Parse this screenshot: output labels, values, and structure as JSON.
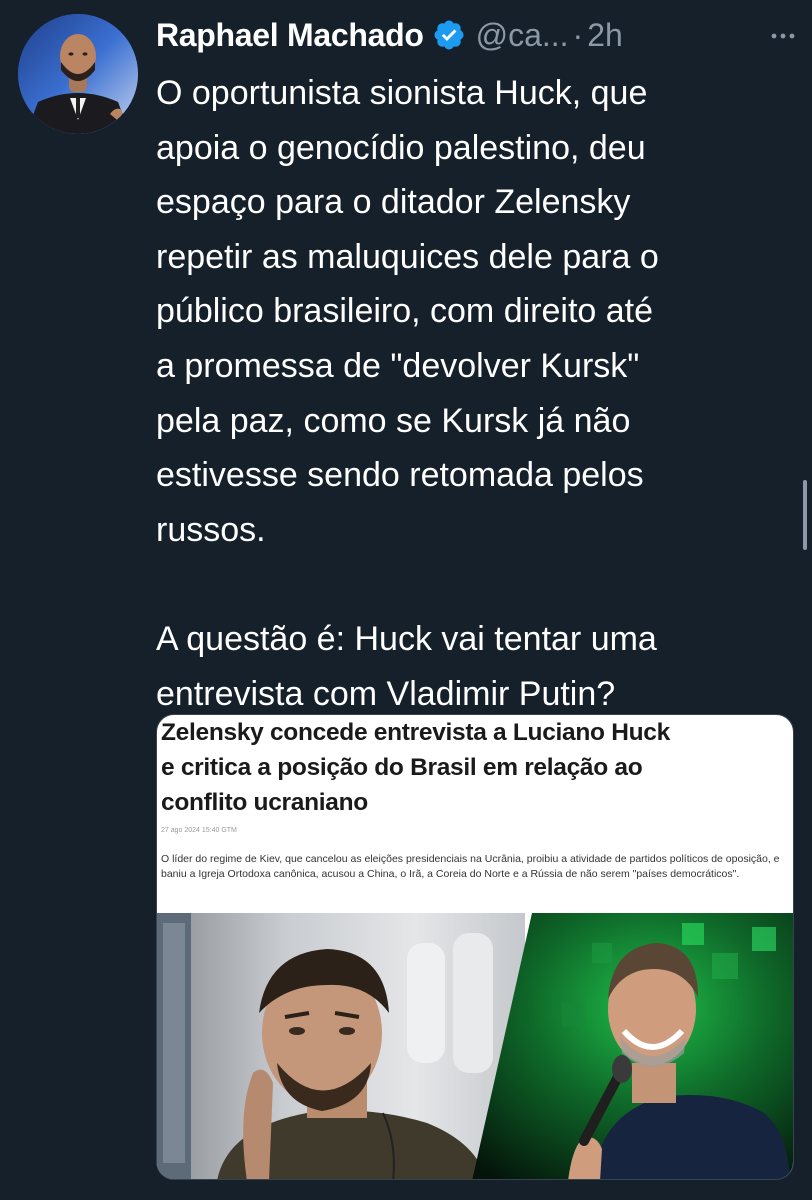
{
  "tweet": {
    "author": {
      "display_name": "Raphael Machado",
      "verified": true,
      "handle": "@ca...",
      "separator": "·",
      "time": "2h"
    },
    "more_icon": "ellipsis-icon",
    "text_lines": [
      "O oportunista sionista Huck, que",
      "apoia o genocídio palestino, deu",
      "espaço para o ditador Zelensky",
      "repetir as maluquices dele para o",
      "público brasileiro, com direito até",
      "a promessa de \"devolver Kursk\"",
      "pela paz, como se Kursk já não",
      "estivesse sendo retomada pelos",
      "russos."
    ],
    "question_lines": [
      "A questão é: Huck vai tentar uma",
      "entrevista com Vladimir Putin?"
    ],
    "media": {
      "headline_lines": [
        "Zelensky concede entrevista a Luciano Huck",
        "e critica a posição do Brasil em relação ao",
        "conflito ucraniano"
      ],
      "date": "27 ago 2024 15:40 GTM",
      "lead": "O líder do regime de Kiev, que cancelou as eleições presidenciais na Ucrânia, proibiu a atividade de partidos políticos de oposição, e baniu a Igreja Ortodoxa canônica, acusou a China, o Irã, a Coreia do Norte e a Rússia de não serem \"países democráticos\"."
    }
  },
  "colors": {
    "background": "#15202b",
    "text_primary": "#ffffff",
    "text_secondary": "#8b98a5",
    "verified_blue": "#1d9bf0"
  }
}
